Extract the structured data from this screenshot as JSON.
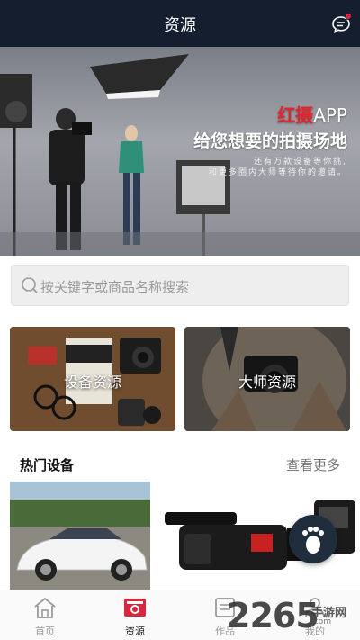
{
  "header": {
    "title": "资源"
  },
  "banner": {
    "brand_red": "红摄",
    "brand_rest": "APP",
    "tagline": "给您想要的拍摄场地",
    "sub_line1": "还有万款设备等你挑,",
    "sub_line2": "和更多圈内大师等待你的邀请。"
  },
  "search": {
    "placeholder": "按关键字或商品名称搜索"
  },
  "categories": [
    {
      "label": "设备资源"
    },
    {
      "label": "大师资源"
    }
  ],
  "hot": {
    "title": "热门设备",
    "more": "查看更多"
  },
  "tabbar": {
    "items": [
      {
        "label": "首页"
      },
      {
        "label": "资源"
      },
      {
        "label": "作品"
      },
      {
        "label": "我的"
      }
    ],
    "active_index": 1
  },
  "watermark": {
    "number": "2265",
    "site": "手游网",
    "domain": ".com"
  },
  "colors": {
    "header_bg": "#141e2e",
    "accent_red": "#d7263d",
    "fab_bg": "#1f2d3d"
  }
}
